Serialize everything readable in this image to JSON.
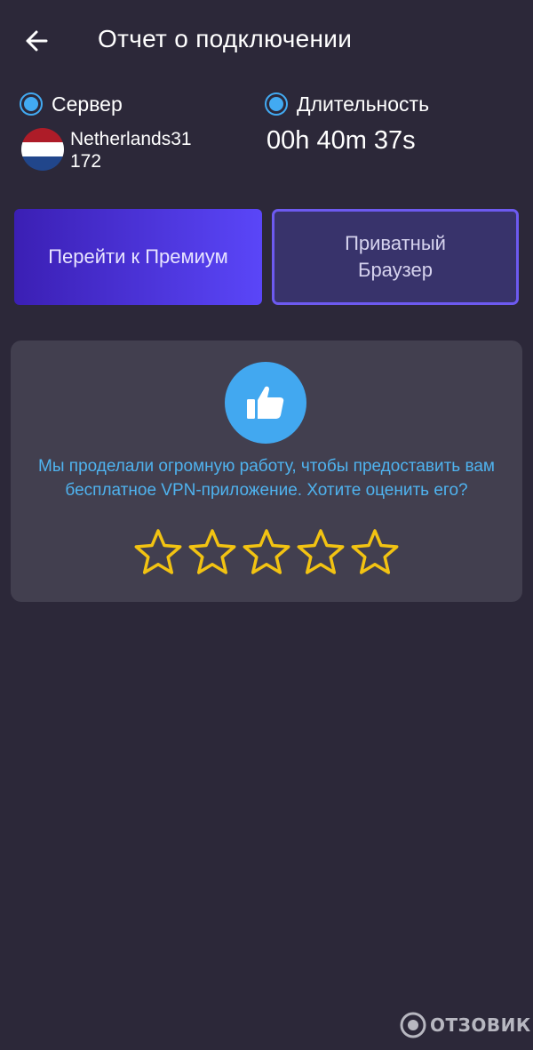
{
  "header": {
    "back_icon": "arrow-left-icon",
    "title": "Отчет о подключении"
  },
  "server": {
    "label": "Сервер",
    "name": "Netherlands31",
    "ip_partial": "172",
    "flag_icon": "netherlands-flag-icon",
    "flag_colors": [
      "#ae1c28",
      "#ffffff",
      "#21468b"
    ]
  },
  "duration": {
    "label": "Длительность",
    "value": "00h 40m 37s"
  },
  "buttons": {
    "premium_label": "Перейти к Премиум",
    "browser_label": "Приватный Браузер"
  },
  "rating": {
    "icon": "thumbs-up-icon",
    "message": "Мы проделали огромную работу, чтобы предоставить вам бесплатное VPN-приложение. Хотите оценить его?",
    "stars_total": 5,
    "stars_selected": 0
  },
  "watermark": {
    "text": "ОТЗОВИК"
  },
  "colors": {
    "background": "#2c2839",
    "accent_blue": "#42aaf2",
    "premium_gradient_start": "#3b1fb4",
    "premium_gradient_end": "#5a46f8",
    "browser_border": "#6d5af0",
    "card_background": "#423f4f",
    "star_color": "#f2c312",
    "rate_text": "#4fb3ef"
  }
}
